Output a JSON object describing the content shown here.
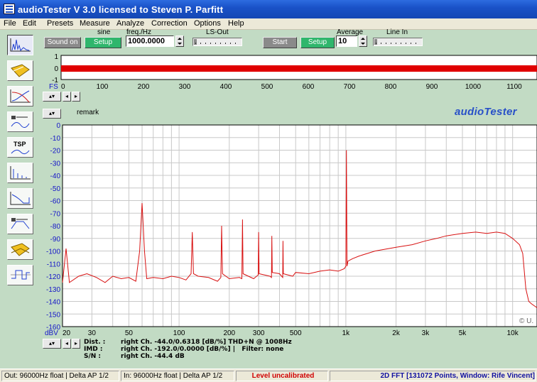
{
  "window": {
    "title": "audioTester  V 3.0   licensed to Steven P. Parfitt"
  },
  "menu": [
    {
      "label": "File",
      "u": "F",
      "rest": "ile"
    },
    {
      "label": "Edit",
      "u": "E",
      "rest": "dit"
    },
    {
      "label": "Presets",
      "u": "P",
      "rest": "resets"
    },
    {
      "label": "Measure",
      "u": "M",
      "rest": "easure"
    },
    {
      "label": "Analyze",
      "u": "A",
      "rest": "nalyze"
    },
    {
      "label": "Correction",
      "u": "C",
      "rest": "orrection"
    },
    {
      "label": "Options",
      "u": "O",
      "rest": "ptions"
    },
    {
      "label": "Help",
      "u": "H",
      "rest": "elp"
    }
  ],
  "toolbar": {
    "sound_on": "Sound on",
    "generator_label": "sine",
    "setup_gen": "Setup",
    "freq_label": "freq./Hz",
    "freq_value": "1000.0000",
    "ls_out_label": "LS-Out",
    "start": "Start",
    "setup_an": "Setup",
    "average_label": "Average",
    "average_value": "10",
    "line_in_label": "Line In"
  },
  "sidebar": [
    {
      "name": "spectrum-fft-icon",
      "active": true
    },
    {
      "name": "presets-folder-icon"
    },
    {
      "name": "frequency-response-icon"
    },
    {
      "name": "impedance-icon"
    },
    {
      "name": "tsp-icon",
      "text": "TSP"
    },
    {
      "name": "distortion-icon"
    },
    {
      "name": "step-response-icon"
    },
    {
      "name": "filter-response-icon"
    },
    {
      "name": "open-folder-icon"
    },
    {
      "name": "square-wave-icon"
    }
  ],
  "level_meter": {
    "y_ticks": [
      "1",
      "0",
      "-1"
    ],
    "fs_label": "FS",
    "x_ticks": [
      "0",
      "100",
      "200",
      "300",
      "400",
      "500",
      "600",
      "700",
      "800",
      "900",
      "1000",
      "1100"
    ],
    "bar_color": "#e00000"
  },
  "graph": {
    "remark": "remark",
    "brand": "audioTester",
    "copyright": "© U.",
    "y_unit": "dBV",
    "y_ticks": [
      "0",
      "-10",
      "-20",
      "-30",
      "-40",
      "-50",
      "-60",
      "-70",
      "-80",
      "-90",
      "-100",
      "-110",
      "-120",
      "-130",
      "-140",
      "-150",
      "-160"
    ],
    "x_ticks": [
      "20",
      "30",
      "50",
      "100",
      "200",
      "300",
      "500",
      "1k",
      "2k",
      "3k",
      "5k",
      "10k"
    ],
    "trace_color": "#d81010"
  },
  "chart_data": {
    "type": "line",
    "title": "",
    "xlabel": "",
    "ylabel": "dBV",
    "x_scale": "log",
    "xlim": [
      20,
      14000
    ],
    "ylim": [
      -160,
      0
    ],
    "grid": true,
    "series": [
      {
        "x": [
          20,
          21,
          22,
          25,
          28,
          32,
          36,
          40,
          45,
          50,
          55,
          58,
          60,
          62,
          64,
          70,
          80,
          90,
          100,
          110,
          118,
          120,
          122,
          130,
          150,
          170,
          178,
          180,
          182,
          200,
          230,
          238,
          240,
          242,
          280,
          298,
          300,
          302,
          350,
          358,
          360,
          362,
          400,
          418,
          420,
          422,
          480,
          500,
          600,
          700,
          800,
          900,
          980,
          1000,
          1008,
          1016,
          1030,
          1100,
          1200,
          1500,
          2000,
          2500,
          3000,
          3500,
          4000,
          5000,
          6000,
          7000,
          8000,
          9000,
          10000,
          11000,
          11500,
          12000,
          12500,
          13000,
          14000
        ],
        "y": [
          -125,
          -98,
          -125,
          -120,
          -118,
          -121,
          -125,
          -120,
          -122,
          -121,
          -124,
          -100,
          -62,
          -100,
          -122,
          -121,
          -122,
          -120,
          -121,
          -123,
          -118,
          -85,
          -118,
          -120,
          -121,
          -124,
          -121,
          -80,
          -118,
          -122,
          -121,
          -122,
          -75,
          -118,
          -122,
          -119,
          -85,
          -118,
          -120,
          -121,
          -88,
          -117,
          -118,
          -121,
          -92,
          -118,
          -120,
          -117,
          -118,
          -116,
          -115,
          -116,
          -114,
          -112,
          -20,
          -112,
          -108,
          -106,
          -104,
          -100,
          -97,
          -95,
          -92,
          -90,
          -88,
          -86,
          -85,
          -86,
          -85,
          -86,
          -90,
          -95,
          -102,
          -130,
          -140,
          -142,
          -145
        ]
      }
    ]
  },
  "info": {
    "dist_label": "Dist. :",
    "dist_value": "right Ch. -44.0/0.6318 [dB/%] THD+N @ 1008Hz",
    "imd_label": "IMD :",
    "imd_value": "right Ch. -192.0/0.0000 [dB/%] |   Filter: none",
    "sn_label": "S/N :",
    "sn_value": "right Ch. -44.4 dB"
  },
  "status": {
    "out": "Out: 96000Hz float  | Delta AP 1/2",
    "in": "In: 96000Hz float  | Delta AP 1/2",
    "level": "Level uncalibrated",
    "fft": "2D FFT [131072 Points, Window: Rife Vincent]"
  }
}
